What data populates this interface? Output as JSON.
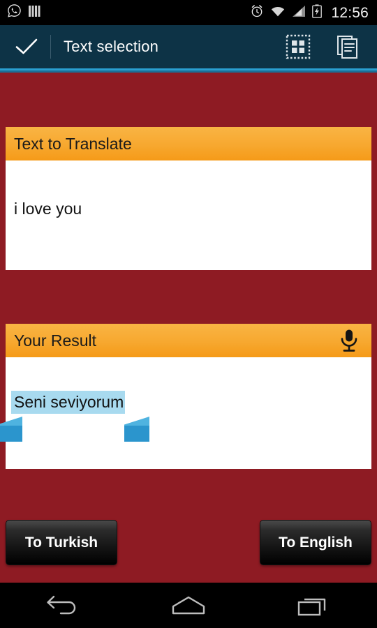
{
  "status_bar": {
    "notification_icons": [
      "whatsapp-icon",
      "signal-bars-notification-icon"
    ],
    "system_icons": [
      "alarm-icon",
      "wifi-icon",
      "cellular-signal-icon",
      "battery-charging-icon"
    ],
    "time": "12:56"
  },
  "action_bar": {
    "done_icon": "check-icon",
    "title": "Text selection",
    "actions": [
      {
        "name": "select-all-icon",
        "label": "Select all"
      },
      {
        "name": "copy-icon",
        "label": "Copy"
      }
    ]
  },
  "cards": {
    "source": {
      "header": "Text to Translate",
      "text": "i love you"
    },
    "result": {
      "header": "Your Result",
      "mic_icon": "microphone-icon",
      "text": "Seni seviyorum",
      "selection_highlight": "#a8daef",
      "handle_color": "#2e9fd4"
    }
  },
  "buttons": {
    "to_turkish": "To Turkish",
    "to_english": "To English"
  },
  "nav_bar": {
    "back": "back-icon",
    "home": "home-icon",
    "recents": "recent-apps-icon"
  },
  "colors": {
    "background": "#8E1B23",
    "action_bar": "#0D3346",
    "accent_line": "#2a9fd0",
    "card_header_orange": "#f7a82f",
    "selection": "#a8daef"
  }
}
